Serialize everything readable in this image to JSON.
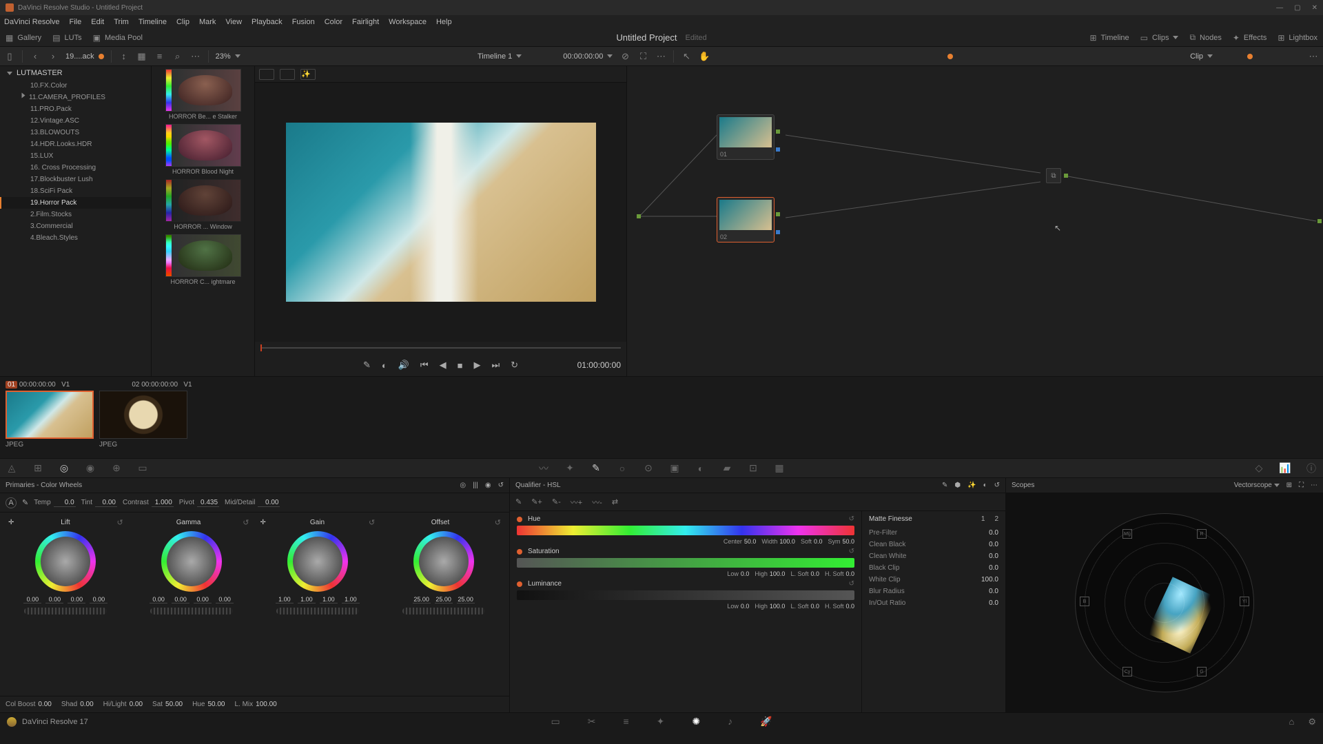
{
  "window": {
    "app": "DaVinci Resolve Studio",
    "title": "Untitled Project"
  },
  "menu": [
    "DaVinci Resolve",
    "File",
    "Edit",
    "Trim",
    "Timeline",
    "Clip",
    "Mark",
    "View",
    "Playback",
    "Fusion",
    "Color",
    "Fairlight",
    "Workspace",
    "Help"
  ],
  "pagetabs": {
    "left": [
      {
        "label": "Gallery"
      },
      {
        "label": "LUTs"
      },
      {
        "label": "Media Pool"
      }
    ],
    "project": "Untitled Project",
    "status": "Edited",
    "right": [
      {
        "label": "Timeline"
      },
      {
        "label": "Clips"
      },
      {
        "label": "Nodes"
      },
      {
        "label": "Effects"
      },
      {
        "label": "Lightbox"
      }
    ]
  },
  "toolbar": {
    "breadcrumb": "19....ack",
    "zoom": "23%",
    "timeline": "Timeline 1",
    "tc": "00:00:00:00",
    "clip": "Clip"
  },
  "luts": {
    "root": "LUTMASTER",
    "items": [
      {
        "label": "10.FX.Color"
      },
      {
        "label": "11.CAMERA_PROFILES",
        "exp": true
      },
      {
        "label": "11.PRO.Pack"
      },
      {
        "label": "12.Vintage.ASC"
      },
      {
        "label": "13.BLOWOUTS"
      },
      {
        "label": "14.HDR.Looks.HDR"
      },
      {
        "label": "15.LUX"
      },
      {
        "label": "16. Cross Processing"
      },
      {
        "label": "17.Blockbuster Lush"
      },
      {
        "label": "18.SciFi Pack"
      },
      {
        "label": "19.Horror Pack",
        "sel": true
      },
      {
        "label": "2.Film.Stocks"
      },
      {
        "label": "3.Commercial"
      },
      {
        "label": "4.Bleach.Styles"
      }
    ],
    "thumbs": [
      "HORROR Be... e Stalker",
      "HORROR Blood Night",
      "HORROR ... Window",
      "HORROR C... ightmare"
    ]
  },
  "viewer": {
    "tc": "01:00:00:00"
  },
  "nodegraph": {
    "nodes": [
      {
        "id": "01"
      },
      {
        "id": "02",
        "sel": true
      }
    ]
  },
  "clips": [
    {
      "badge": "01",
      "tc": "00:00:00:00",
      "track": "V1",
      "type": "JPEG",
      "sel": true,
      "img": "beach"
    },
    {
      "badge": "02",
      "tc": "00:00:00:00",
      "track": "V1",
      "type": "JPEG",
      "img": "coffee"
    }
  ],
  "primaries": {
    "title": "Primaries - Color Wheels",
    "row": {
      "temp_l": "Temp",
      "temp": "0.0",
      "tint_l": "Tint",
      "tint": "0.00",
      "con_l": "Contrast",
      "contrast": "1.000",
      "piv_l": "Pivot",
      "pivot": "0.435",
      "md_l": "Mid/Detail",
      "md": "0.00"
    },
    "wheels": [
      {
        "name": "Lift",
        "vals": [
          "0.00",
          "0.00",
          "0.00",
          "0.00"
        ]
      },
      {
        "name": "Gamma",
        "vals": [
          "0.00",
          "0.00",
          "0.00",
          "0.00"
        ]
      },
      {
        "name": "Gain",
        "vals": [
          "1.00",
          "1.00",
          "1.00",
          "1.00"
        ]
      },
      {
        "name": "Offset",
        "vals": [
          "25.00",
          "25.00",
          "25.00"
        ]
      }
    ],
    "footer": {
      "cb_l": "Col Boost",
      "cb": "0.00",
      "sh_l": "Shad",
      "sh": "0.00",
      "hl_l": "Hi/Light",
      "hl": "0.00",
      "sat_l": "Sat",
      "sat": "50.00",
      "hue_l": "Hue",
      "hue": "50.00",
      "lm_l": "L. Mix",
      "lm": "100.00"
    }
  },
  "qualifier": {
    "title": "Qualifier - HSL",
    "hue": {
      "name": "Hue",
      "center_l": "Center",
      "center": "50.0",
      "width_l": "Width",
      "width": "100.0",
      "soft_l": "Soft",
      "soft": "0.0",
      "sym_l": "Sym",
      "sym": "50.0"
    },
    "sat": {
      "name": "Saturation",
      "low_l": "Low",
      "low": "0.0",
      "high_l": "High",
      "high": "100.0",
      "ls_l": "L. Soft",
      "ls": "0.0",
      "hs_l": "H. Soft",
      "hs": "0.0"
    },
    "lum": {
      "name": "Luminance",
      "low_l": "Low",
      "low": "0.0",
      "high_l": "High",
      "high": "100.0",
      "ls_l": "L. Soft",
      "ls": "0.0",
      "hs_l": "H. Soft",
      "hs": "0.0"
    },
    "matte": {
      "title": "Matte Finesse",
      "tabs": [
        "1",
        "2"
      ],
      "rows": [
        {
          "l": "Pre-Filter",
          "v": "0.0"
        },
        {
          "l": "Clean Black",
          "v": "0.0"
        },
        {
          "l": "Clean White",
          "v": "0.0"
        },
        {
          "l": "Black Clip",
          "v": "0.0"
        },
        {
          "l": "White Clip",
          "v": "100.0"
        },
        {
          "l": "Blur Radius",
          "v": "0.0"
        },
        {
          "l": "In/Out Ratio",
          "v": "0.0"
        }
      ]
    }
  },
  "scopes": {
    "title": "Scopes",
    "type": "Vectorscope"
  },
  "footer": {
    "app": "DaVinci Resolve 17"
  }
}
